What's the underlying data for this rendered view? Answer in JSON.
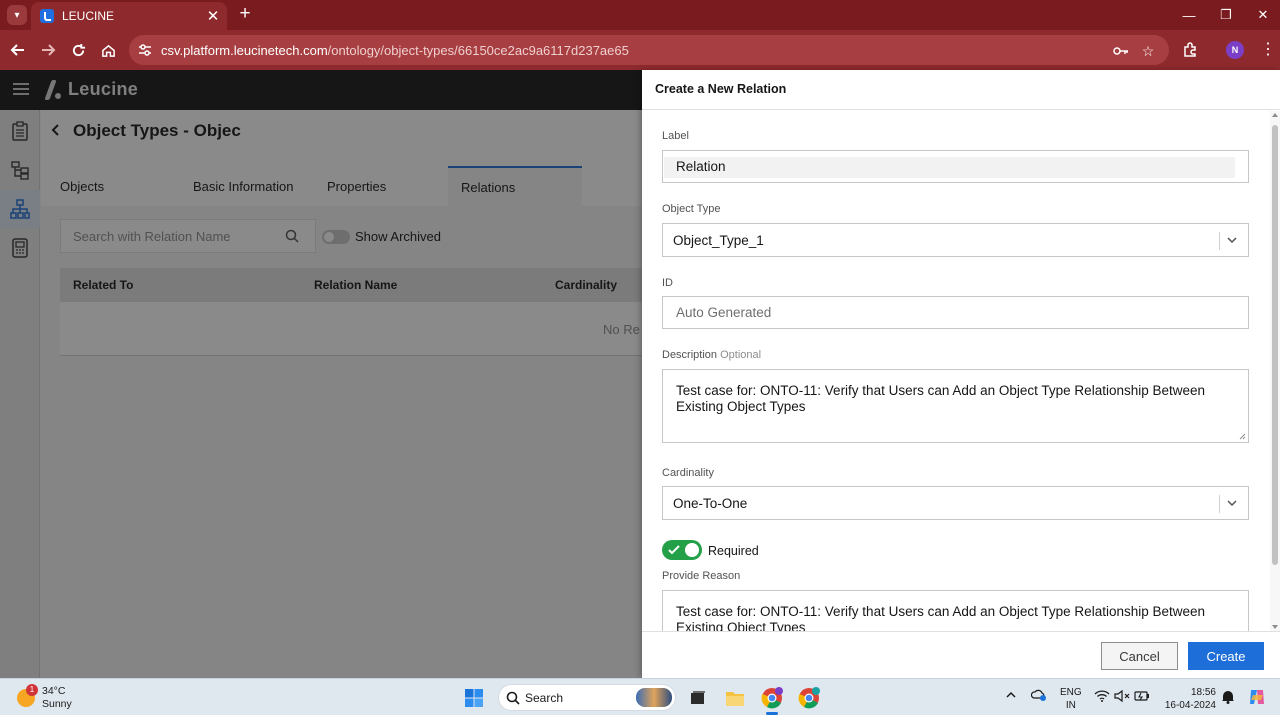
{
  "browser": {
    "tab_title": "LEUCINE",
    "url_host": "csv.platform.leucinetech.com",
    "url_path": "/ontology/object-types/66150ce2ac9a6117d237ae65",
    "profile_initial": "N",
    "accent": "#8e2a2d"
  },
  "app": {
    "logo_text": "Leucine",
    "page_title": "Object Types - Objec",
    "tabs": [
      "Objects",
      "Basic Information",
      "Properties",
      "Relations"
    ],
    "active_tab": "Relations",
    "search_placeholder": "Search with Relation Name",
    "show_archived_label": "Show Archived",
    "table_headers": [
      "Related To",
      "Relation Name",
      "Cardinality"
    ],
    "empty_text": "No Re"
  },
  "drawer": {
    "title": "Create a New Relation",
    "label_label": "Label",
    "label_value": "Relation",
    "object_type_label": "Object Type",
    "object_type_value": "Object_Type_1",
    "id_label": "ID",
    "id_placeholder": "Auto Generated",
    "description_label": "Description",
    "description_optional": "Optional",
    "description_line1": "Test case for: ONTO-11: Verify that Users can Add an Object Type Relationship Between",
    "description_line2": "Existing Object Types",
    "cardinality_label": "Cardinality",
    "cardinality_value": "One-To-One",
    "required_label": "Required",
    "required_on": true,
    "reason_label": "Provide Reason",
    "reason_line1": "Test case for: ONTO-11: Verify that Users can Add an Object Type Relationship Between",
    "reason_line2": "Existing Object Types",
    "cancel_label": "Cancel",
    "create_label": "Create",
    "primary_color": "#1d6ed9",
    "toggle_color": "#24a148"
  },
  "taskbar": {
    "temperature": "34°C",
    "weather": "Sunny",
    "weather_badge": "1",
    "search_label": "Search",
    "lang_line1": "ENG",
    "lang_line2": "IN",
    "time": "18:56",
    "date": "16-04-2024"
  }
}
